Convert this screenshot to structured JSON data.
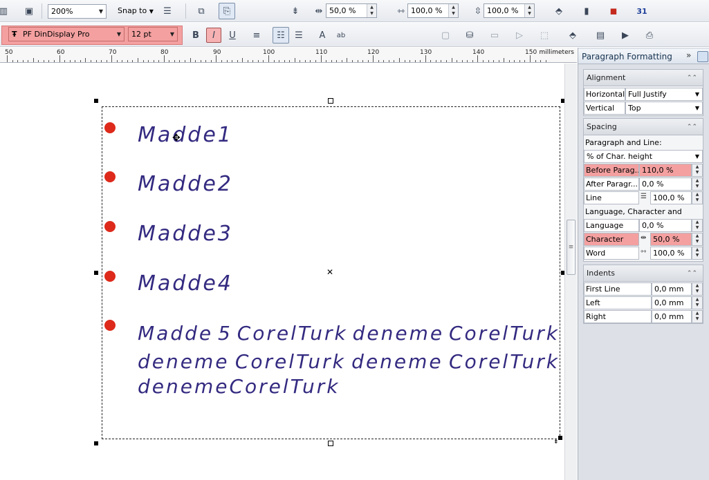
{
  "toolbar_top": {
    "zoom": "200%",
    "snap_to": "Snap to",
    "scale_h": "50,0 %",
    "scale_w": "100,0 %",
    "scale_line": "100,0 %"
  },
  "toolbar_text": {
    "font": "PF DinDisplay Pro",
    "size": "12 pt"
  },
  "ruler": {
    "unit": "millimeters",
    "labels": [
      "50",
      "60",
      "70",
      "80",
      "90",
      "100",
      "110",
      "120",
      "130",
      "140",
      "150"
    ]
  },
  "document": {
    "items": [
      "Madde1",
      "Madde2",
      "Madde3",
      "Madde4"
    ],
    "para5": {
      "line1": [
        "Madde",
        "5",
        "CorelTurk",
        "deneme",
        "CorelTurk"
      ],
      "line2": [
        "deneme",
        "CorelTurk",
        "deneme",
        "CorelTurk"
      ],
      "line3": "denemeCorelTurk"
    },
    "bullet_color": "#dd2a1b",
    "text_color": "#332a80"
  },
  "panel": {
    "title": "Paragraph Formatting",
    "alignment": {
      "title": "Alignment",
      "horizontal_label": "Horizontal",
      "horizontal_value": "Full Justify",
      "vertical_label": "Vertical",
      "vertical_value": "Top"
    },
    "spacing": {
      "title": "Spacing",
      "para_line_label": "Paragraph and Line:",
      "unit_value": "% of Char. height",
      "before_label": "Before Parag...",
      "before_value": "110,0 %",
      "after_label": "After Paragr...",
      "after_value": "0,0 %",
      "line_label": "Line",
      "line_value": "100,0 %",
      "lang_char_word_label": "Language, Character and Word:",
      "language_label": "Language",
      "language_value": "0,0 %",
      "character_label": "Character",
      "character_value": "50,0 %",
      "word_label": "Word",
      "word_value": "100,0 %"
    },
    "indents": {
      "title": "Indents",
      "first_line_label": "First Line",
      "first_line_value": "0,0 mm",
      "left_label": "Left",
      "left_value": "0,0 mm",
      "right_label": "Right",
      "right_value": "0,0 mm"
    },
    "highlight_color": "#f4a0a0"
  }
}
